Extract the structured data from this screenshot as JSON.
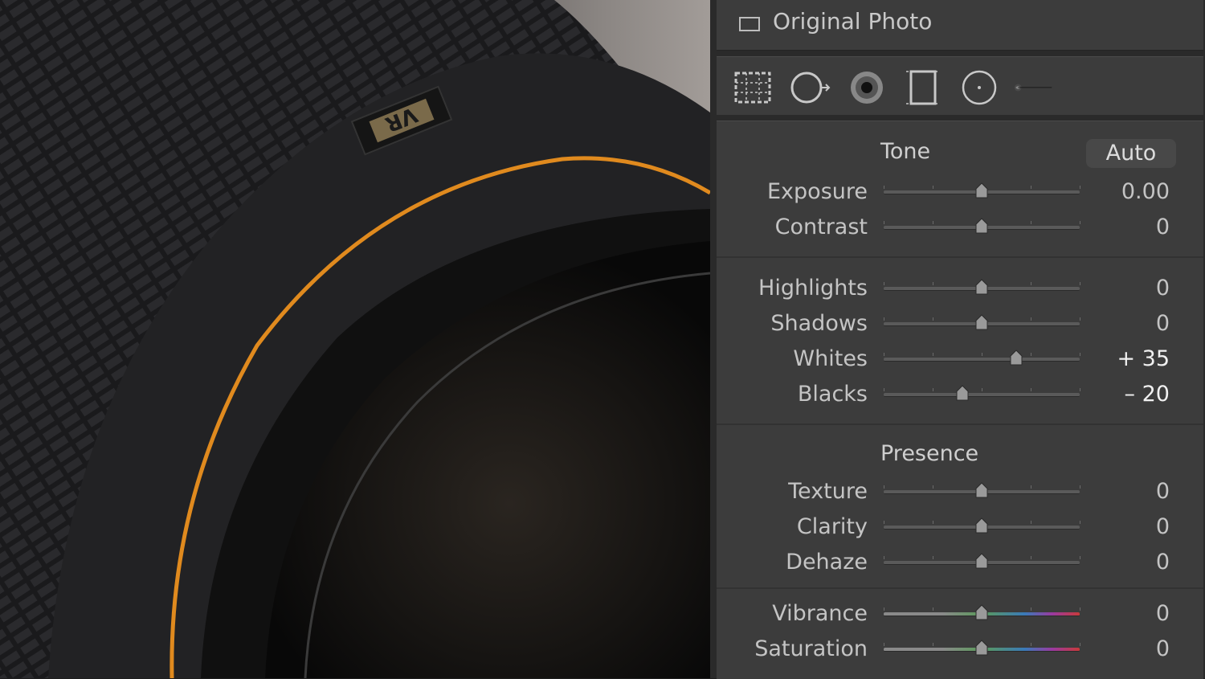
{
  "original_photo": {
    "label": "Original Photo"
  },
  "lens_badge": "VR",
  "toolbar": {
    "tools": [
      "crop-overlay-icon",
      "spot-removal-icon",
      "red-eye-icon",
      "graduated-filter-icon",
      "radial-filter-icon",
      "adjustment-brush-icon"
    ],
    "brush_slider_value": 0.05
  },
  "tone": {
    "title": "Tone",
    "auto_label": "Auto",
    "sliders": [
      {
        "label": "Exposure",
        "value_text": "0.00",
        "position": 0.5
      },
      {
        "label": "Contrast",
        "value_text": "0",
        "position": 0.5
      }
    ],
    "sliders2": [
      {
        "label": "Highlights",
        "value_text": "0",
        "position": 0.5
      },
      {
        "label": "Shadows",
        "value_text": "0",
        "position": 0.5
      },
      {
        "label": "Whites",
        "value_text": "+ 35",
        "position": 0.675
      },
      {
        "label": "Blacks",
        "value_text": "– 20",
        "position": 0.4
      }
    ]
  },
  "presence": {
    "title": "Presence",
    "sliders": [
      {
        "label": "Texture",
        "value_text": "0",
        "position": 0.5
      },
      {
        "label": "Clarity",
        "value_text": "0",
        "position": 0.5
      },
      {
        "label": "Dehaze",
        "value_text": "0",
        "position": 0.5
      }
    ],
    "sliders2": [
      {
        "label": "Vibrance",
        "value_text": "0",
        "position": 0.5
      },
      {
        "label": "Saturation",
        "value_text": "0",
        "position": 0.5
      }
    ]
  },
  "colors": {
    "panel_bg": "#3c3c3c",
    "text": "#c4c4c4",
    "lens_ring": "#e08a1e"
  }
}
